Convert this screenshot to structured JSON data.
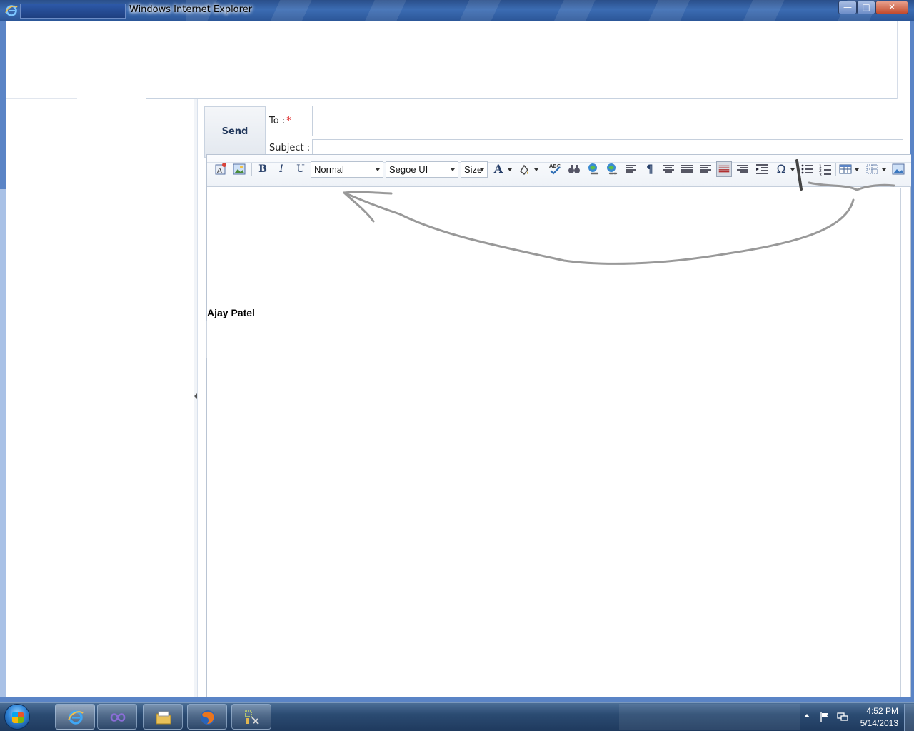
{
  "window": {
    "title": "Windows Internet Explorer",
    "buttons": {
      "minimize": "—",
      "maximize": "□",
      "close": "✕"
    }
  },
  "compose": {
    "send_label": "Send",
    "to_label": "To :",
    "to_required": "*",
    "to_value": "",
    "subject_label": "Subject :",
    "subject_value": ""
  },
  "editor": {
    "toolbar": {
      "bold": "B",
      "italic": "I",
      "underline": "U",
      "paragraph_format": "Normal",
      "font_name": "Segoe UI",
      "font_size": "Size",
      "font_color_icon": "A",
      "special_chars_icon": "Ω"
    },
    "signature": "Ajay Patel"
  },
  "taskbar": {
    "apps": [
      "internet-explorer",
      "visual-studio",
      "file-explorer",
      "firefox",
      "tools"
    ],
    "active_app": "internet-explorer"
  },
  "clock": {
    "time": "4:52 PM",
    "date": "5/14/2013"
  }
}
